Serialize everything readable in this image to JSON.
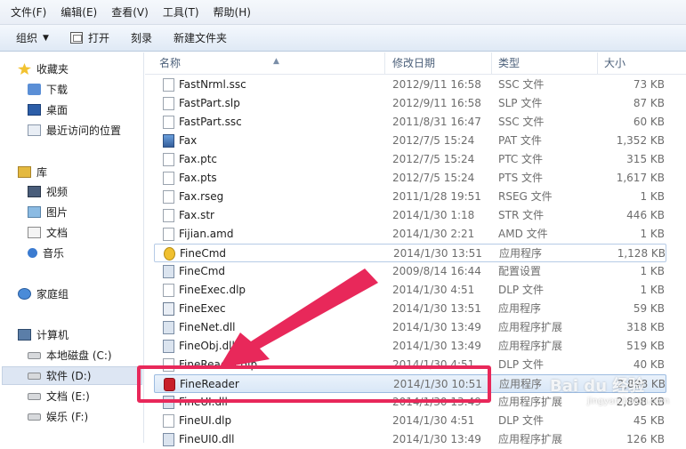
{
  "menu": [
    "文件(F)",
    "编辑(E)",
    "查看(V)",
    "工具(T)",
    "帮助(H)"
  ],
  "toolbar": {
    "organize": "组织",
    "open": "打开",
    "burn": "刻录",
    "new_folder": "新建文件夹"
  },
  "nav": {
    "favorites": "收藏夹",
    "downloads": "下载",
    "desktop": "桌面",
    "recent": "最近访问的位置",
    "libraries": "库",
    "videos": "视频",
    "pictures": "图片",
    "documents": "文档",
    "music": "音乐",
    "homegroup": "家庭组",
    "computer": "计算机",
    "drive_c": "本地磁盘 (C:)",
    "drive_d": "软件 (D:)",
    "drive_e": "文档 (E:)",
    "drive_f": "娱乐 (F:)"
  },
  "columns": {
    "name": "名称",
    "date": "修改日期",
    "type": "类型",
    "size": "大小"
  },
  "files": [
    {
      "name": "FastNrml.ssc",
      "date": "2012/9/11 16:58",
      "type": "SSC 文件",
      "size": "73 KB",
      "icon": "file"
    },
    {
      "name": "FastPart.slp",
      "date": "2012/9/11 16:58",
      "type": "SLP 文件",
      "size": "87 KB",
      "icon": "file"
    },
    {
      "name": "FastPart.ssc",
      "date": "2011/8/31 16:47",
      "type": "SSC 文件",
      "size": "60 KB",
      "icon": "file"
    },
    {
      "name": "Fax",
      "date": "2012/7/5 15:24",
      "type": "PAT 文件",
      "size": "1,352 KB",
      "icon": "fax"
    },
    {
      "name": "Fax.ptc",
      "date": "2012/7/5 15:24",
      "type": "PTC 文件",
      "size": "315 KB",
      "icon": "file"
    },
    {
      "name": "Fax.pts",
      "date": "2012/7/5 15:24",
      "type": "PTS 文件",
      "size": "1,617 KB",
      "icon": "file"
    },
    {
      "name": "Fax.rseg",
      "date": "2011/1/28 19:51",
      "type": "RSEG 文件",
      "size": "1 KB",
      "icon": "file"
    },
    {
      "name": "Fax.str",
      "date": "2014/1/30 1:18",
      "type": "STR 文件",
      "size": "446 KB",
      "icon": "file"
    },
    {
      "name": "Fijian.amd",
      "date": "2014/1/30 2:21",
      "type": "AMD 文件",
      "size": "1 KB",
      "icon": "file"
    },
    {
      "name": "FineCmd",
      "date": "2014/1/30 13:51",
      "type": "应用程序",
      "size": "1,128 KB",
      "icon": "gear"
    },
    {
      "name": "FineCmd",
      "date": "2009/8/14 16:44",
      "type": "配置设置",
      "size": "1 KB",
      "icon": "exe"
    },
    {
      "name": "FineExec.dlp",
      "date": "2014/1/30 4:51",
      "type": "DLP 文件",
      "size": "1 KB",
      "icon": "file"
    },
    {
      "name": "FineExec",
      "date": "2014/1/30 13:51",
      "type": "应用程序",
      "size": "59 KB",
      "icon": "app"
    },
    {
      "name": "FineNet.dll",
      "date": "2014/1/30 13:49",
      "type": "应用程序扩展",
      "size": "318 KB",
      "icon": "exe"
    },
    {
      "name": "FineObj.dll",
      "date": "2014/1/30 13:49",
      "type": "应用程序扩展",
      "size": "519 KB",
      "icon": "exe"
    },
    {
      "name": "FineReader.dlp",
      "date": "2014/1/30 4:51",
      "type": "DLP 文件",
      "size": "40 KB",
      "icon": "file"
    },
    {
      "name": "FineReader",
      "date": "2014/1/30 10:51",
      "type": "应用程序",
      "size": "2,898 KB",
      "icon": "fr"
    },
    {
      "name": "FineUI.dll",
      "date": "2014/1/30 13:49",
      "type": "应用程序扩展",
      "size": "2,898 KB",
      "icon": "exe"
    },
    {
      "name": "FineUI.dlp",
      "date": "2014/1/30 4:51",
      "type": "DLP 文件",
      "size": "45 KB",
      "icon": "file"
    },
    {
      "name": "FineUI0.dll",
      "date": "2014/1/30 13:49",
      "type": "应用程序扩展",
      "size": "126 KB",
      "icon": "exe"
    }
  ],
  "watermark": {
    "brand": "Bai du 经验",
    "url": "jingyan.baidu.com"
  },
  "colors": {
    "callout": "#e8285a",
    "selection": "#d9e7f7"
  }
}
